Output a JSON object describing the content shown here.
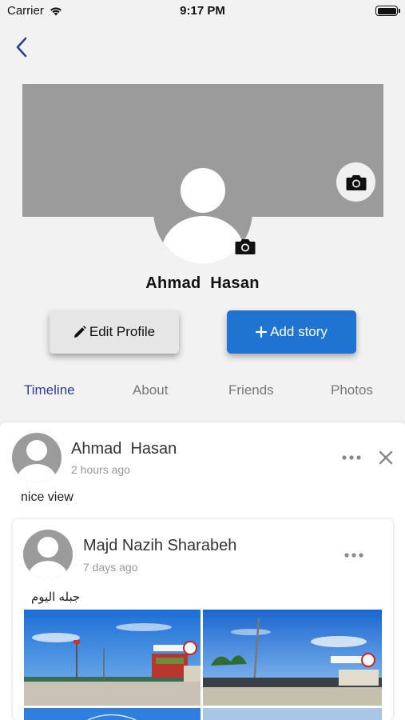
{
  "status_bar": {
    "carrier": "Carrier",
    "time": "9:17 PM"
  },
  "profile": {
    "name": "Ahmad  Hasan",
    "edit_label": "Edit Profile",
    "story_label": "Add story"
  },
  "tabs": [
    "Timeline",
    "About",
    "Friends",
    "Photos"
  ],
  "post": {
    "author": "Ahmad  Hasan",
    "time": "2 hours ago",
    "text": "nice view",
    "shared": {
      "author": "Majd Nazih Sharabeh",
      "time": "7 days ago",
      "text": "جبله اليوم"
    }
  },
  "colors": {
    "accent": "#1f74d2",
    "active_tab": "#2c3e91",
    "cover": "#9b9b9b"
  },
  "icons": [
    "wifi-icon",
    "battery-icon",
    "back-chevron-icon",
    "camera-icon",
    "pencil-icon",
    "plus-icon",
    "more-icon",
    "close-icon",
    "default-avatar-icon"
  ]
}
